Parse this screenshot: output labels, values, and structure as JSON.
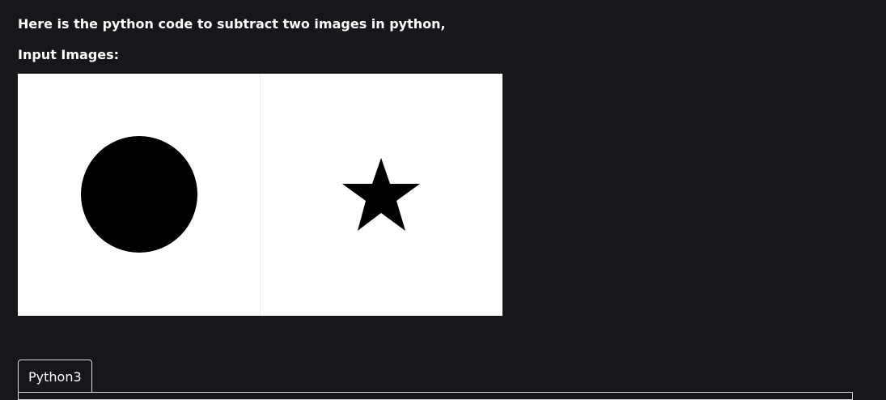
{
  "article": {
    "intro_text": "Here is the python code to subtract two images in python,",
    "input_images_label": "Input Images:"
  },
  "images": [
    {
      "name": "circle",
      "shape": "circle-shape",
      "fill": "#000000"
    },
    {
      "name": "star",
      "shape": "star-shape",
      "fill": "#000000"
    }
  ],
  "code_tabs": [
    {
      "label": "Python3",
      "selected": true
    }
  ],
  "colors": {
    "page_background": "#16171b",
    "text": "#ffffff",
    "image_background": "#ffffff",
    "tab_border": "#d8d8d8"
  }
}
